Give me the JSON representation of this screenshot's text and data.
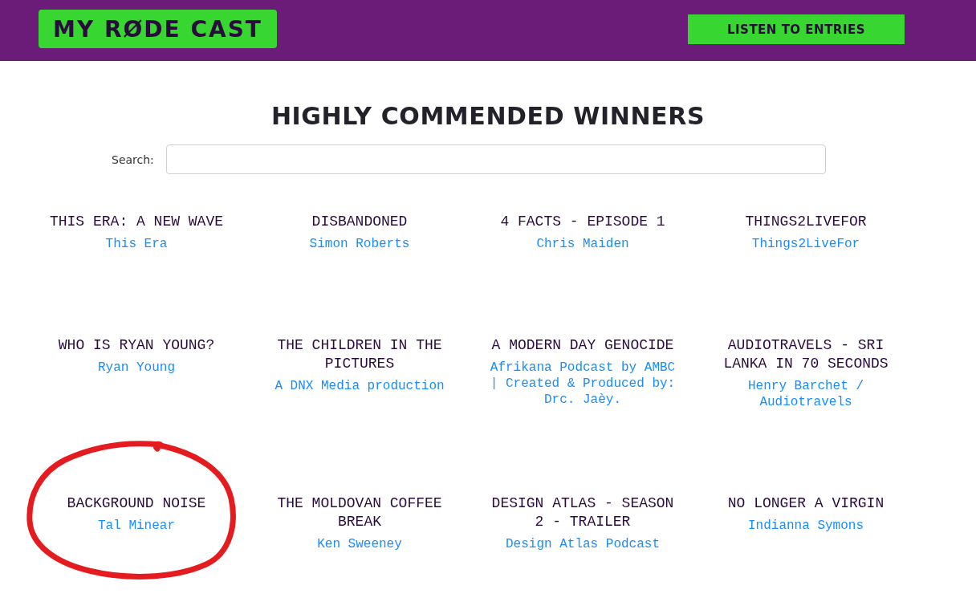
{
  "header": {
    "logo": "MY RØDE CAST",
    "button": "LISTEN TO ENTRIES"
  },
  "page": {
    "title": "HIGHLY COMMENDED WINNERS",
    "search": {
      "label": "Search:"
    }
  },
  "entries": [
    {
      "title": "THIS ERA: A NEW WAVE",
      "author": "This Era",
      "circled": false
    },
    {
      "title": "DISBANDONED",
      "author": "Simon Roberts",
      "circled": false
    },
    {
      "title": "4 FACTS - EPISODE 1",
      "author": "Chris Maiden",
      "circled": false
    },
    {
      "title": "THINGS2LIVEFOR",
      "author": "Things2LiveFor",
      "circled": false
    },
    {
      "title": "WHO IS RYAN YOUNG?",
      "author": "Ryan Young",
      "circled": false
    },
    {
      "title": "THE CHILDREN IN THE PICTURES",
      "author": "A DNX Media production",
      "circled": false
    },
    {
      "title": "A MODERN DAY GENOCIDE",
      "author": "Afrikana Podcast by AMBC | Created & Produced by: Drc. Jaèy.",
      "circled": false
    },
    {
      "title": "AUDIOTRAVELS - SRI LANKA IN 70 SECONDS",
      "author": "Henry Barchet / Audiotravels",
      "circled": false
    },
    {
      "title": "BACKGROUND NOISE",
      "author": "Tal Minear",
      "circled": true
    },
    {
      "title": "THE MOLDOVAN COFFEE BREAK",
      "author": "Ken Sweeney",
      "circled": false
    },
    {
      "title": "DESIGN ATLAS - SEASON 2 - TRAILER",
      "author": "Design Atlas Podcast",
      "circled": false
    },
    {
      "title": "NO LONGER A VIRGIN",
      "author": "Indianna Symons",
      "circled": false
    }
  ]
}
